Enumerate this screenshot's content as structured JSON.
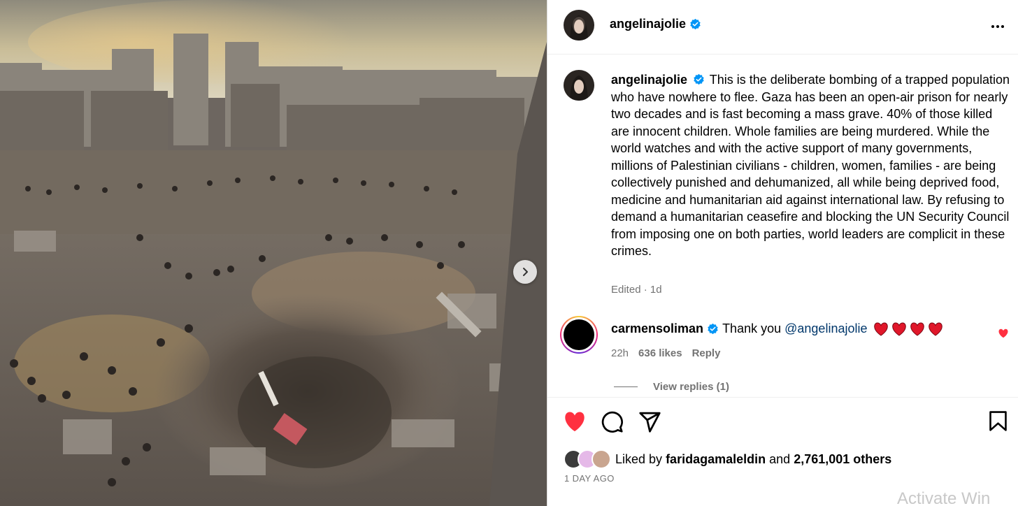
{
  "header": {
    "username": "angelinajolie"
  },
  "caption": {
    "username": "angelinajolie",
    "text": "This is the deliberate bombing of a trapped population who have nowhere to flee. Gaza has been an open-air prison for nearly two decades and is fast becoming a mass grave. 40% of those killed are innocent children. Whole families are being murdered. While the world watches and with the active support of many governments, millions of Palestinian civilians - children, women, families - are being collectively punished and dehumanized, all while being deprived food, medicine and humanitarian aid against international law. By refusing to demand a humanitarian ceasefire and blocking the UN Security Council from imposing one on both parties, world leaders are complicit in these crimes.",
    "edited": "Edited",
    "time": "1d"
  },
  "comment": {
    "username": "carmensoliman",
    "text": "Thank you",
    "mention": "@angelinajolie",
    "time": "22h",
    "likes": "636 likes",
    "reply": "Reply",
    "view_replies": "View replies (1)"
  },
  "likes": {
    "prefix": "Liked by",
    "user": "faridagamaleldin",
    "and": "and",
    "count": "2,761,001 others"
  },
  "posted": "1 DAY AGO",
  "watermark": "Activate Win",
  "colors": {
    "like_red": "#ff3040",
    "verified_blue": "#0095f6",
    "link": "#00376b"
  },
  "icons": [
    "verified-icon",
    "more-icon",
    "heart-icon",
    "comment-icon",
    "share-icon",
    "bookmark-icon",
    "chevron-right-icon"
  ]
}
